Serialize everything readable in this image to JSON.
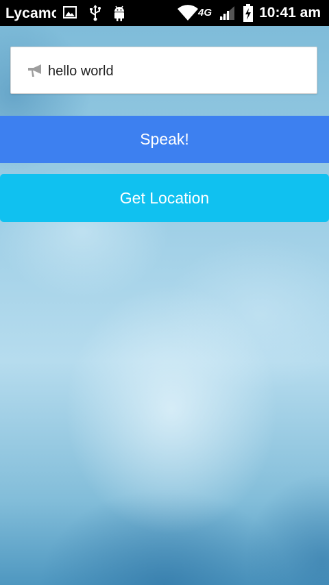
{
  "status_bar": {
    "carrier": "Lycamo",
    "network_type": "4G",
    "time": "10:41 am",
    "icons": [
      "image-icon",
      "usb-icon",
      "android-icon",
      "wifi-icon",
      "signal-icon",
      "battery-charging-icon"
    ]
  },
  "speech_input": {
    "value": "hello world",
    "icon": "megaphone-icon"
  },
  "buttons": {
    "speak_label": "Speak!",
    "location_label": "Get Location"
  },
  "colors": {
    "speak_button": "#3d80f0",
    "location_button": "#10c1f0",
    "status_bar": "#000000"
  }
}
